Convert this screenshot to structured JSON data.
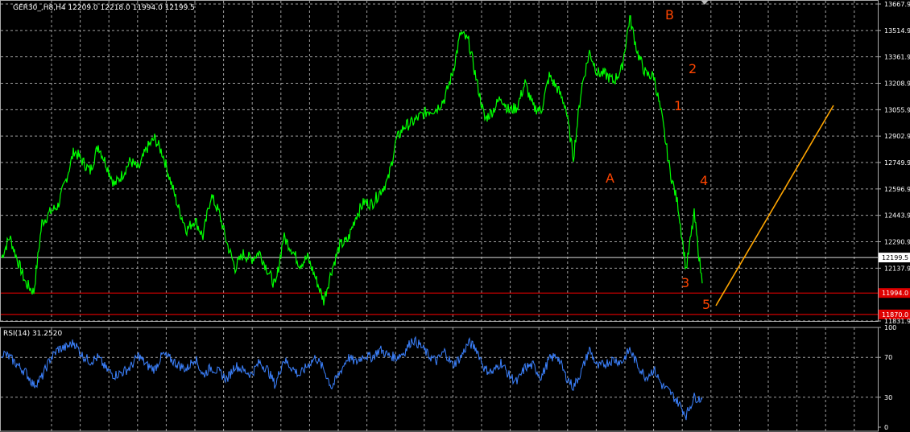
{
  "main_chart": {
    "header": "GER30_,H8,H4  12209.0 12218.0 11994.0 12199.5",
    "price_labels": [
      "13667.9",
      "13514.9",
      "13361.9",
      "13208.9",
      "13055.9",
      "12902.9",
      "12749.9",
      "12596.9",
      "12443.9",
      "12290.9",
      "12137.9",
      "11831.9"
    ],
    "current_price_label": "12199.5",
    "level_labels": [
      "11994.0",
      "11870.0"
    ],
    "annotations": [
      "B",
      "2",
      "1",
      "A",
      "4",
      "3",
      "5"
    ],
    "colors": {
      "background": "#000000",
      "grid": "#c8c8c8",
      "price_line": "#00ff00",
      "level_line": "#ff0000",
      "trend_line": "#ffa500",
      "annotation": "#ff4500",
      "axis_text": "#ffffff"
    }
  },
  "rsi_panel": {
    "header": "RSI(14) 31.2520",
    "labels": [
      "100",
      "70",
      "30",
      "0"
    ],
    "colors": {
      "rsi_line": "#3c82ff",
      "level": "#c8c8c8"
    }
  },
  "chart_data": [
    {
      "type": "line",
      "title": "GER30_,H8,H4  12209.0 12218.0 11994.0 12199.5",
      "ylim": [
        11831.9,
        13667.9
      ],
      "horizontal_levels": [
        12199.5,
        11994.0,
        11870.0
      ],
      "series": [
        {
          "values": [
            12200,
            12320,
            12180,
            12050,
            12000,
            12400,
            12460,
            12500,
            12650,
            12820,
            12760,
            12700,
            12850,
            12740,
            12620,
            12680,
            12760,
            12710,
            12830,
            12890,
            12800,
            12640,
            12480,
            12360,
            12420,
            12320,
            12560,
            12460,
            12280,
            12140,
            12220,
            12190,
            12230,
            12130,
            12030,
            12320,
            12250,
            12160,
            12200,
            12080,
            11950,
            12130,
            12270,
            12300,
            12440,
            12520,
            12510,
            12580,
            12650,
            12880,
            12960,
            12980,
            13020,
            13050,
            13060,
            13120,
            13270,
            13500,
            13450,
            13220,
            13000,
            13050,
            13130,
            13050,
            13070,
            13210,
            13070,
            13050,
            13250,
            13180,
            13080,
            12780,
            13180,
            13390,
            13270,
            13260,
            13220,
            13290,
            13590,
            13380,
            13260,
            13250,
            13010,
            12700,
            12500,
            12130,
            12450,
            12050
          ]
        }
      ]
    },
    {
      "type": "line",
      "title": "RSI(14) 31.2520",
      "ylim": [
        0,
        100
      ],
      "levels": [
        70,
        30
      ],
      "series": [
        {
          "values": [
            75,
            70,
            62,
            55,
            42,
            50,
            68,
            78,
            80,
            85,
            72,
            66,
            70,
            58,
            52,
            55,
            60,
            72,
            62,
            58,
            73,
            68,
            62,
            58,
            70,
            52,
            60,
            55,
            48,
            62,
            57,
            53,
            65,
            58,
            42,
            68,
            60,
            52,
            62,
            70,
            58,
            40,
            55,
            70,
            65,
            72,
            70,
            78,
            72,
            70,
            75,
            88,
            82,
            72,
            66,
            76,
            62,
            70,
            85,
            78,
            58,
            55,
            65,
            52,
            45,
            60,
            62,
            50,
            68,
            72,
            52,
            40,
            56,
            78,
            60,
            64,
            68,
            65,
            78,
            62,
            50,
            58,
            42,
            35,
            25,
            12,
            30,
            28
          ]
        }
      ]
    }
  ]
}
